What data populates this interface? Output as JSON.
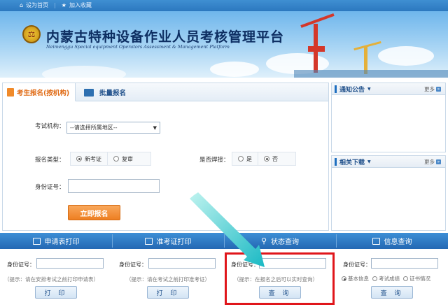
{
  "topbar": {
    "set_home": "设为首页",
    "bookmark": "加入收藏"
  },
  "banner": {
    "title_cn": "内蒙古特种设备作业人员考核管理平台",
    "title_en": "Neimenggu Special equipment Operators Assessment & Management Platform"
  },
  "main": {
    "tab_active": "考生报名(按机构)",
    "tab_batch": "批量报名",
    "exam_org_label": "考试机构：",
    "exam_org_select": "--请选择所属地区--",
    "reg_type_label": "报名类型：",
    "reg_type_new": "新考证",
    "reg_type_renew": "复审",
    "welding_label": "是否焊接：",
    "welding_yes": "是",
    "welding_no": "否",
    "id_label": "身份证号：",
    "submit": "立即报名"
  },
  "side": {
    "notice_title": "通知公告",
    "notice_more": "更多",
    "download_title": "相关下载",
    "download_more": "更多"
  },
  "bottom": {
    "col1": {
      "title": "申请表打印",
      "id_label": "身份证号：",
      "hint": "（提示：请在安排考试之前打印申请表）",
      "button": "打 印"
    },
    "col2": {
      "title": "准考证打印",
      "id_label": "身份证号：",
      "hint": "（提示：请在考试之前打印准考证）",
      "button": "打 印"
    },
    "col3": {
      "title": "状态查询",
      "id_label": "身份证号：",
      "hint": "（提示：在报名之后可以实时查询）",
      "button": "查 询"
    },
    "col4": {
      "title": "信息查询",
      "id_label": "身份证号：",
      "opt1": "基本信息",
      "opt2": "考试成绩",
      "opt3": "证书情况",
      "button": "查 询"
    }
  },
  "colors": {
    "accent_blue": "#2c78bf",
    "accent_orange": "#ee7f22",
    "highlight_red": "#e0161b",
    "arrow_teal": "#2cc7c9"
  }
}
